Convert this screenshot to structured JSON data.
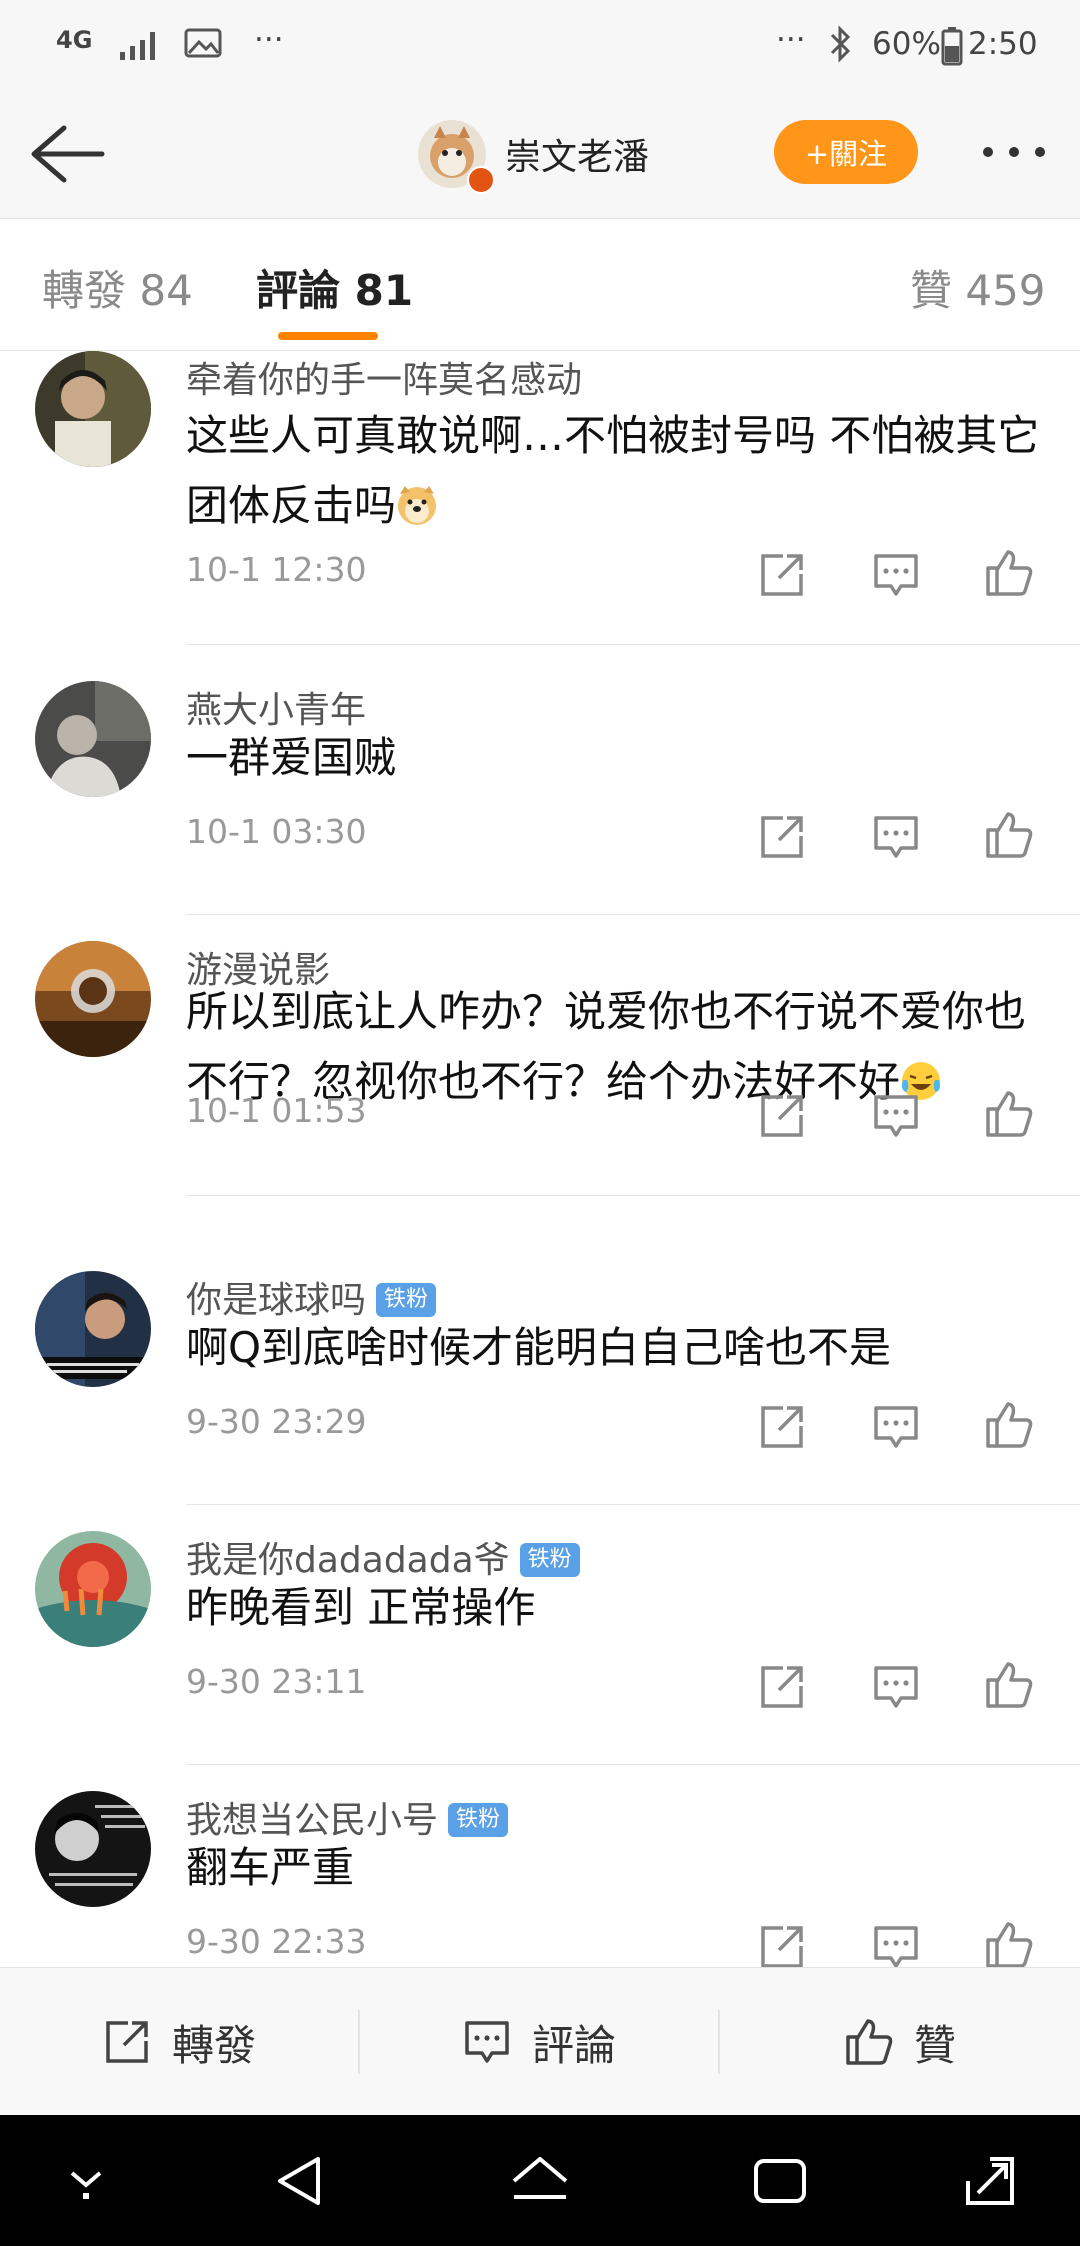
{
  "status": {
    "network": "4G",
    "dots_left": "···",
    "dots_right": "···",
    "battery": "60%",
    "time": "2:50"
  },
  "header": {
    "title": "崇文老潘",
    "follow_label": "+關注"
  },
  "tabs": [
    {
      "label": "轉發 84"
    },
    {
      "label": "評論 81"
    },
    {
      "label": "贊 459"
    }
  ],
  "comments": [
    {
      "user": "牵着你的手一阵莫名感动",
      "text": "这些人可真敢说啊…不怕被封号吗 不怕被其它团体反击吗",
      "emoji": "doge",
      "time": "10-1 12:30",
      "badge": ""
    },
    {
      "user": "燕大小青年",
      "text": "一群爱国贼",
      "emoji": "",
      "time": "10-1 03:30",
      "badge": ""
    },
    {
      "user": "游漫说影",
      "text": "所以到底让人咋办？说爱你也不行说不爱你也不行？忽视你也不行？给个办法好不好",
      "emoji": "laugh-cry",
      "time": "10-1 01:53",
      "badge": ""
    },
    {
      "user": "你是球球吗",
      "text": "啊Q到底啥时候才能明白自己啥也不是",
      "emoji": "",
      "time": "9-30 23:29",
      "badge": "铁粉"
    },
    {
      "user": "我是你dadadada爷",
      "text": "昨晚看到  正常操作",
      "emoji": "",
      "time": "9-30 23:11",
      "badge": "铁粉"
    },
    {
      "user": "我想当公民小号",
      "text": "翻车严重",
      "emoji": "",
      "time": "9-30 22:33",
      "badge": "铁粉"
    }
  ],
  "bottom": {
    "repost": "轉發",
    "comment": "評論",
    "like": "贊"
  },
  "colors": {
    "accent": "#ff8200",
    "follow_button": "#ff9519",
    "badge": "#5aa0e6"
  }
}
